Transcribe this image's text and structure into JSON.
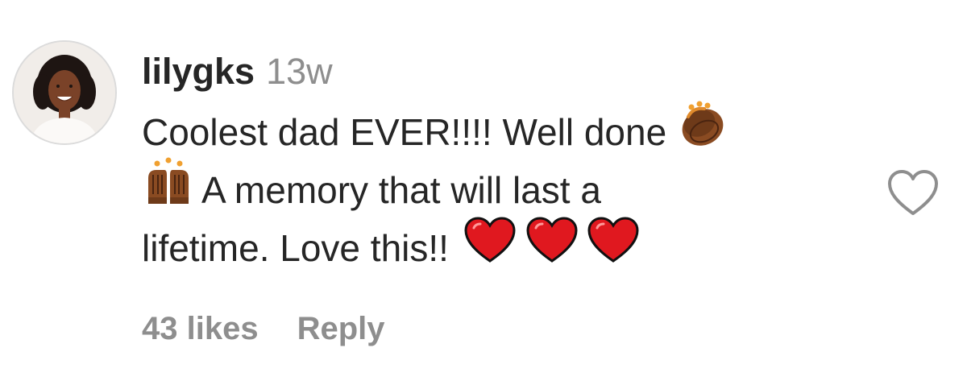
{
  "comment": {
    "username": "lilygks",
    "time": "13w",
    "text_lines": [
      "Coolest dad EVER!!!! Well done",
      "A memory that will last a",
      "lifetime. Love this!!"
    ],
    "likes_label": "43 likes",
    "reply_label": "Reply",
    "icons": {
      "avatar": "profile-photo",
      "emoji_1": "clapping-hands-emoji",
      "emoji_2": "raising-hands-emoji",
      "emoji_3": "red-heart-emoji",
      "like": "heart-outline-icon"
    }
  },
  "colors": {
    "text": "#262626",
    "muted": "#8e8e8e",
    "heart_red": "#e0181f",
    "skin": "#8a4b22"
  }
}
